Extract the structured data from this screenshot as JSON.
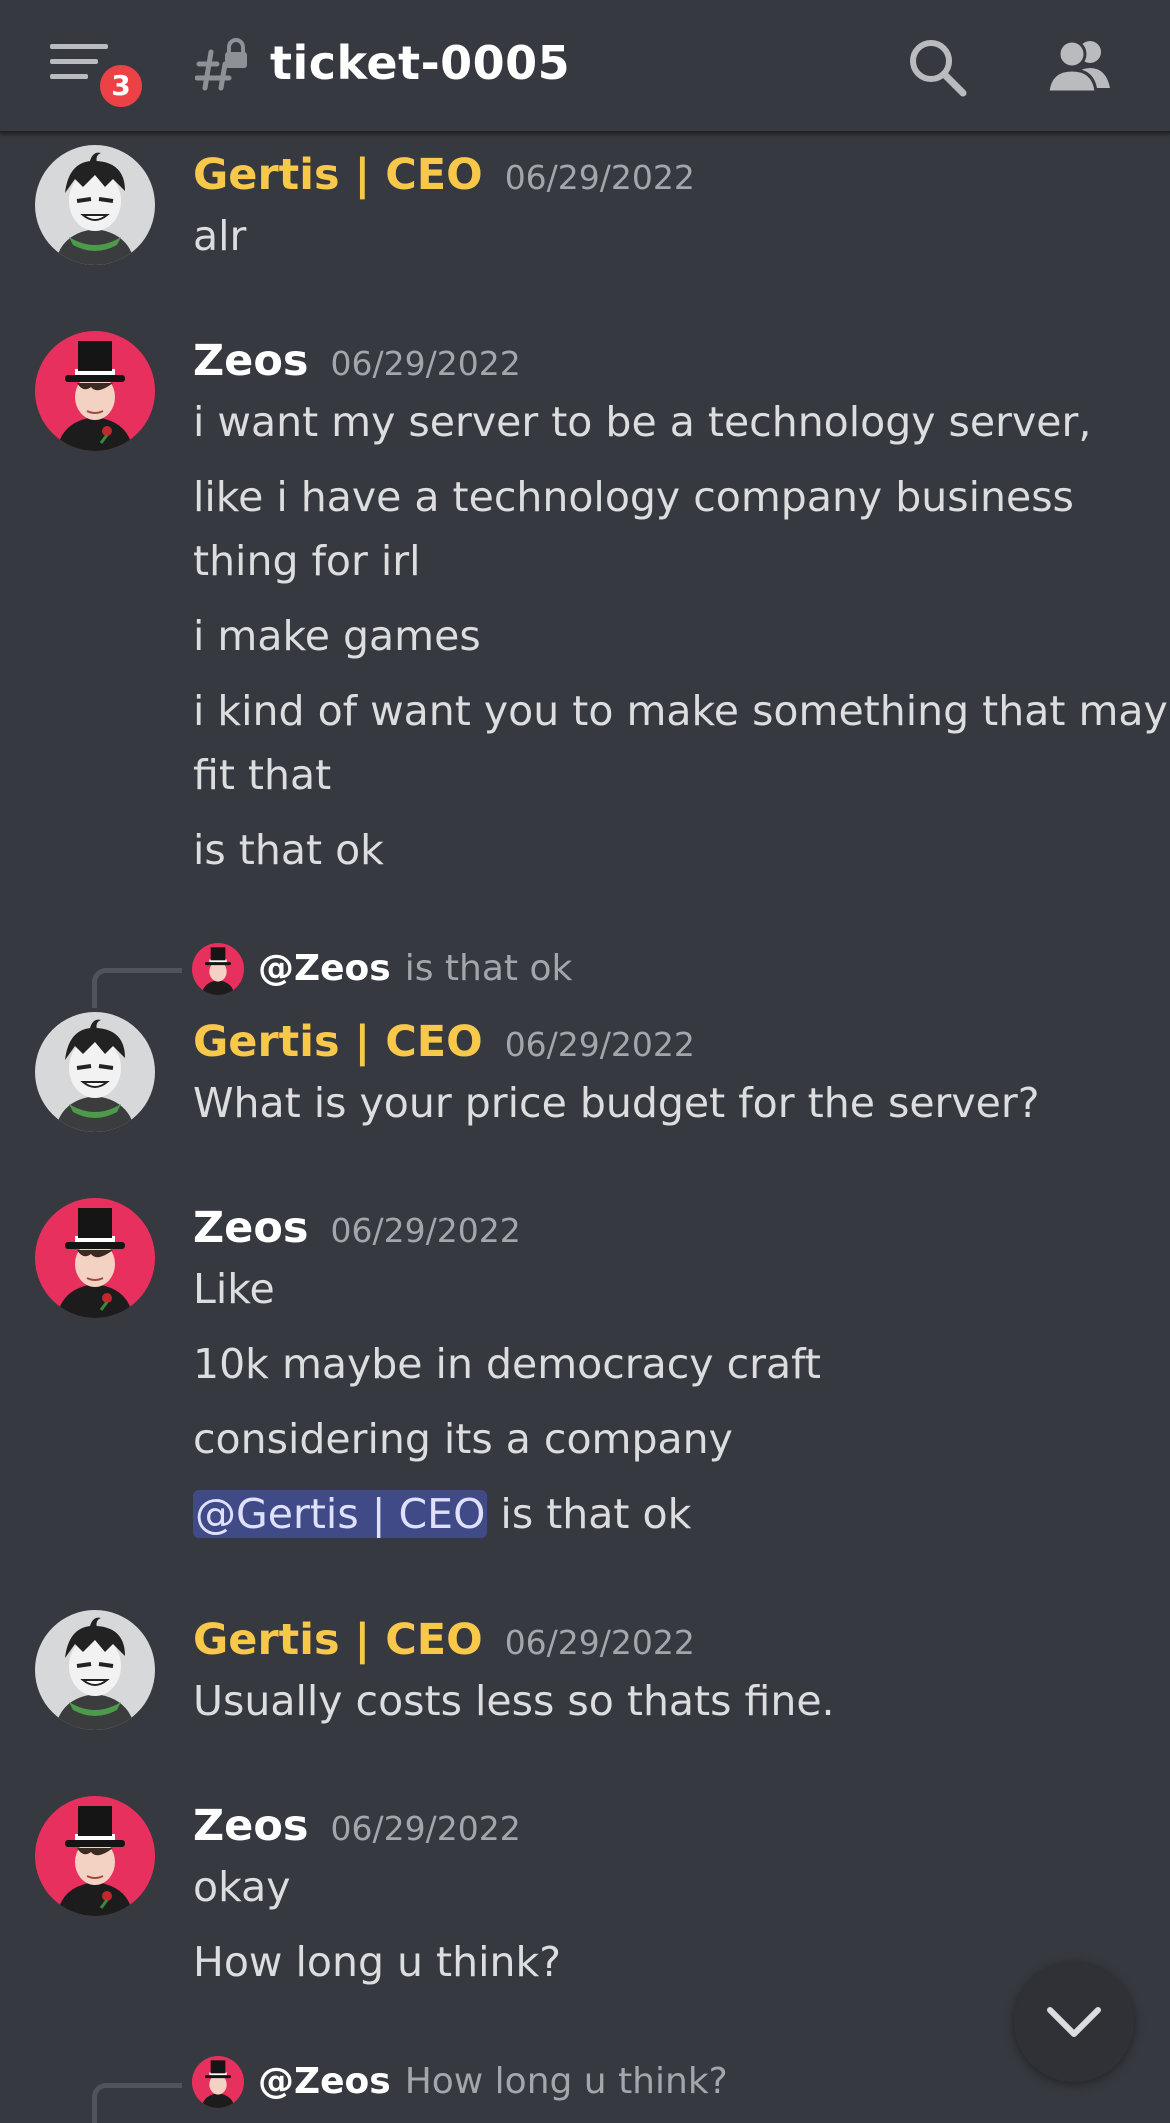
{
  "header": {
    "notification_count": "3",
    "channel_name": "ticket-0005",
    "icons": [
      "menu-icon",
      "locked-channel-icon",
      "search-icon",
      "members-icon"
    ]
  },
  "colors": {
    "background": "#36393f",
    "role_gertis": "#f8c84a",
    "badge": "#ed4245",
    "mention_bg": "#404a87"
  },
  "messages": [
    {
      "author": "Gertis | CEO",
      "timestamp": "06/29/2022",
      "lines": [
        "alr"
      ]
    },
    {
      "author": "Zeos",
      "timestamp": "06/29/2022",
      "lines": [
        "i want my server to be a technology server,",
        "like i have a technology company business",
        "thing for irl",
        "i make games",
        "i kind of want you to make something that may",
        "fit that",
        "is that ok"
      ]
    },
    {
      "reply": {
        "author": "@Zeos",
        "content": "is that ok"
      },
      "author": "Gertis | CEO",
      "timestamp": "06/29/2022",
      "lines": [
        "What is your price budget for the server?"
      ]
    },
    {
      "author": "Zeos",
      "timestamp": "06/29/2022",
      "lines": [
        "Like",
        "10k maybe in democracy craft",
        "considering its a company"
      ],
      "mention_line": {
        "mention": "@Gertis | CEO",
        "rest": "is that ok"
      }
    },
    {
      "author": "Gertis | CEO",
      "timestamp": "06/29/2022",
      "lines": [
        "Usually costs less so thats fine."
      ]
    },
    {
      "author": "Zeos",
      "timestamp": "06/29/2022",
      "lines": [
        "okay",
        "How long u think?"
      ]
    },
    {
      "reply": {
        "author": "@Zeos",
        "content": "How long u think?"
      }
    }
  ]
}
